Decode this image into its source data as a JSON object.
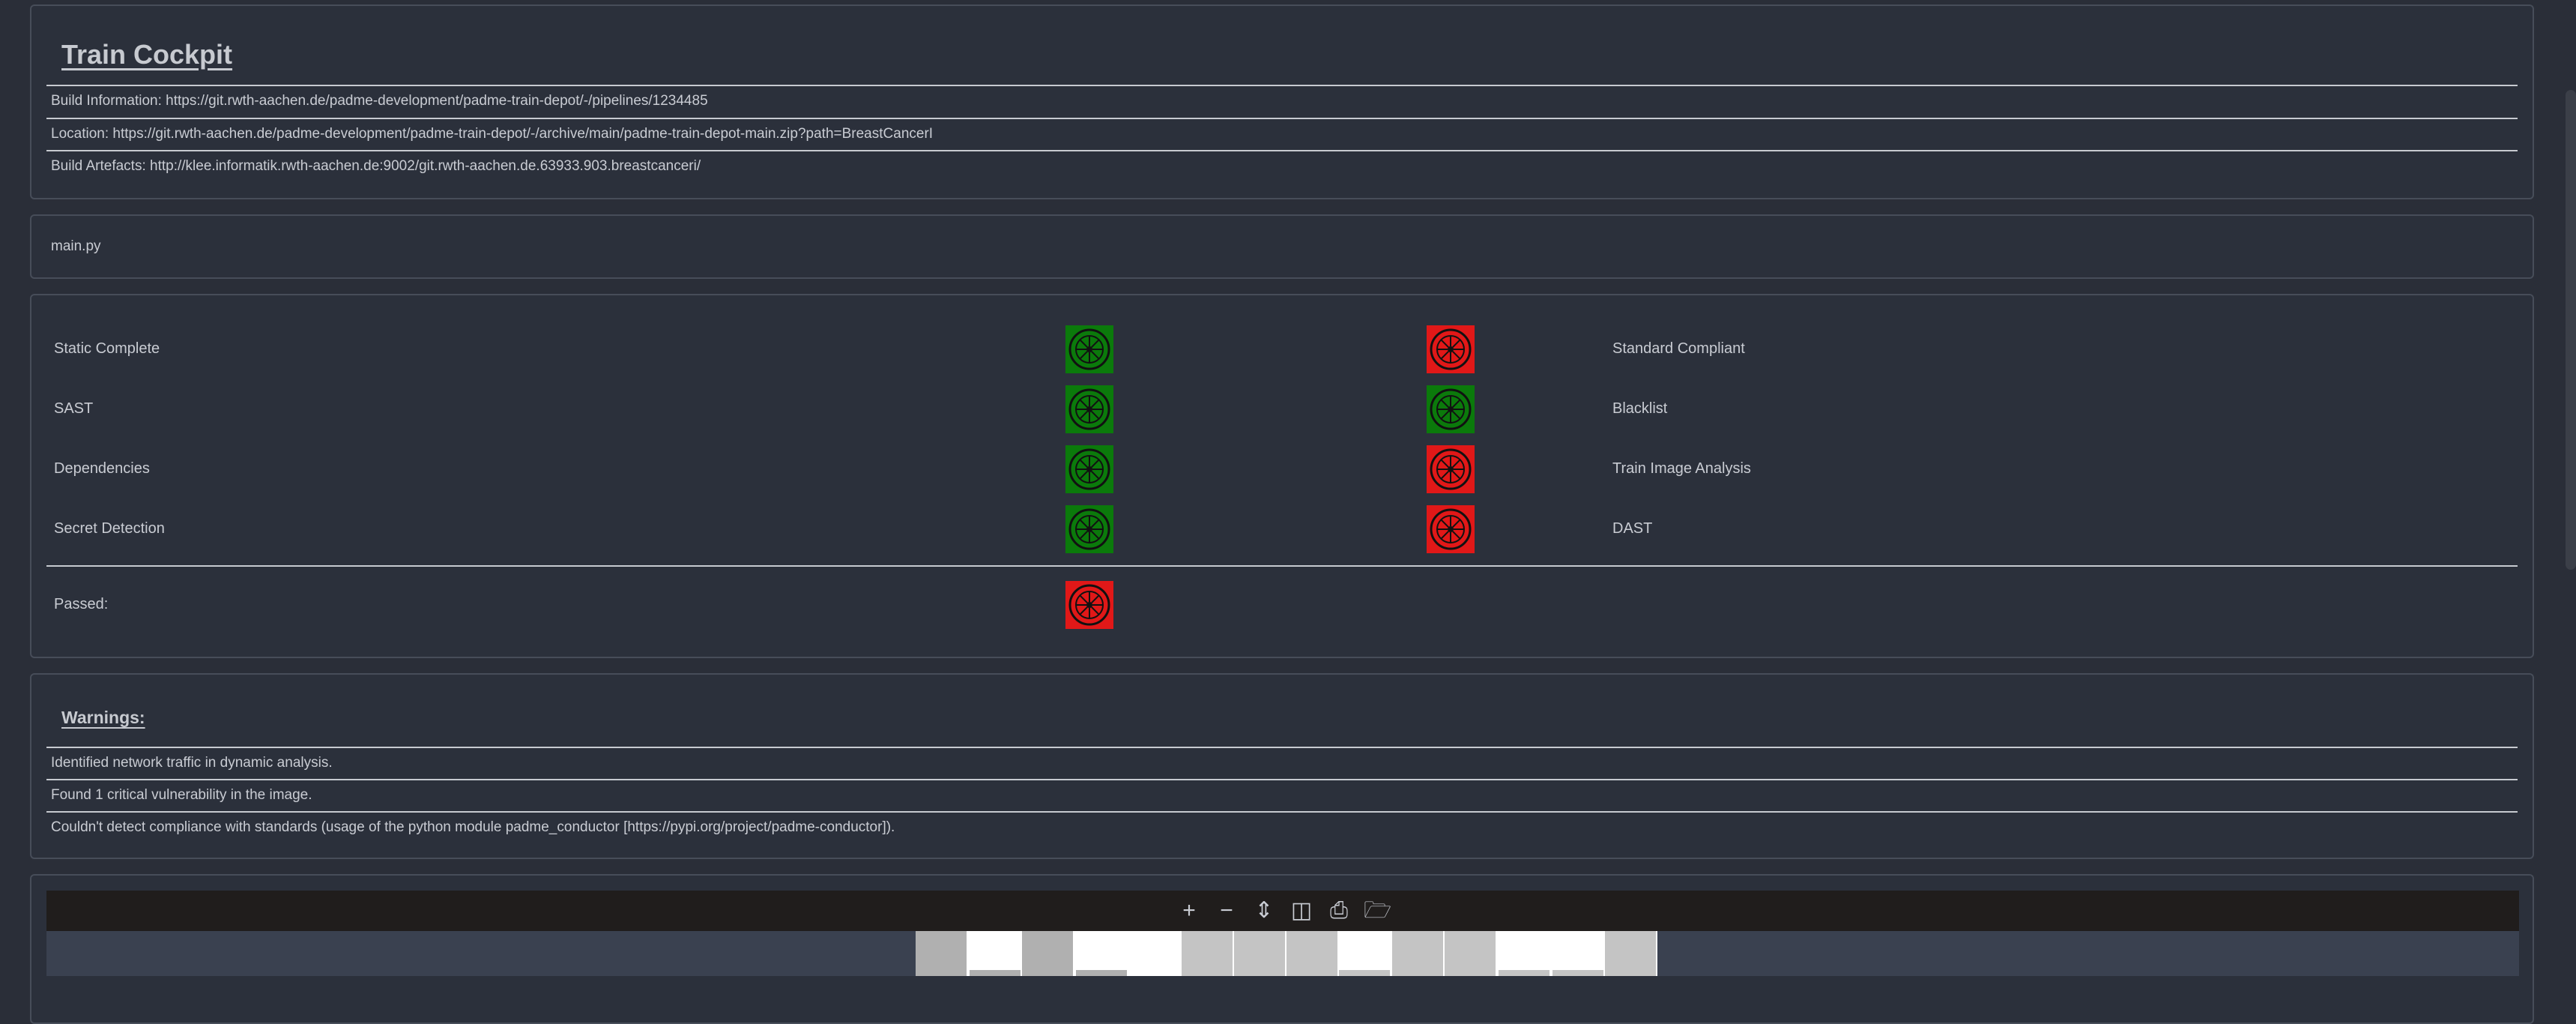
{
  "cockpit": {
    "title": "Train Cockpit",
    "build_information": "Build Information: https://git.rwth-aachen.de/padme-development/padme-train-depot/-/pipelines/1234485",
    "location": "Location: https://git.rwth-aachen.de/padme-development/padme-train-depot/-/archive/main/padme-train-depot-main.zip?path=BreastCancerI",
    "build_artefacts": "Build Artefacts: http://klee.informatik.rwth-aachen.de:9002/git.rwth-aachen.de.63933.903.breastcanceri/"
  },
  "file": {
    "name": "main.py"
  },
  "checks": {
    "left": [
      {
        "label": "Static Complete",
        "status": "passed",
        "color": "#0b7a0b"
      },
      {
        "label": "SAST",
        "status": "passed",
        "color": "#0b7a0b"
      },
      {
        "label": "Dependencies",
        "status": "passed",
        "color": "#0b7a0b"
      },
      {
        "label": "Secret Detection",
        "status": "passed",
        "color": "#0b7a0b"
      }
    ],
    "right": [
      {
        "label": "Standard Compliant",
        "status": "failed",
        "color": "#e11818"
      },
      {
        "label": "Blacklist",
        "status": "passed",
        "color": "#0b7a0b"
      },
      {
        "label": "Train Image Analysis",
        "status": "failed",
        "color": "#e11818"
      },
      {
        "label": "DAST",
        "status": "failed",
        "color": "#e11818"
      }
    ],
    "passed": {
      "label": "Passed:",
      "status": "failed",
      "color": "#e11818"
    }
  },
  "warnings": {
    "title": "Warnings:",
    "items": [
      "Identified network traffic in dynamic analysis.",
      "Found 1 critical vulnerability in the image.",
      "Couldn't detect compliance with standards (usage of the python module padme_conductor [https://pypi.org/project/padme-conductor])."
    ]
  },
  "viewer": {
    "toolbar": [
      {
        "name": "zoom-in-icon",
        "glyph": "+"
      },
      {
        "name": "zoom-out-icon",
        "glyph": "−"
      },
      {
        "name": "fit-height-icon",
        "glyph": "⇕"
      },
      {
        "name": "two-page-icon",
        "glyph": "◫"
      },
      {
        "name": "print-icon",
        "glyph": "⎙"
      },
      {
        "name": "open-folder-icon",
        "glyph": "🗁"
      }
    ]
  },
  "colors": {
    "background": "#2a2e38",
    "panel": "#2b303b",
    "pass": "#0b7a0b",
    "fail": "#e11818"
  }
}
